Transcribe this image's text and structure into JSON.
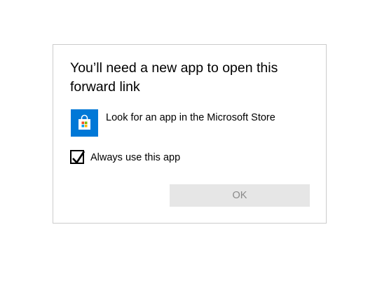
{
  "dialog": {
    "title": "You’ll need a new app to open this forward link",
    "store_option": {
      "icon": "microsoft-store-icon",
      "label": "Look for an app in the Microsoft Store"
    },
    "always_use": {
      "label": "Always use this app",
      "checked": true
    },
    "ok_button": {
      "label": "OK",
      "enabled": false
    }
  },
  "colors": {
    "store_icon_bg": "#0078d7",
    "button_bg_disabled": "#e6e6e6",
    "button_text_disabled": "#8a8a8a",
    "dialog_border": "#cccccc"
  }
}
